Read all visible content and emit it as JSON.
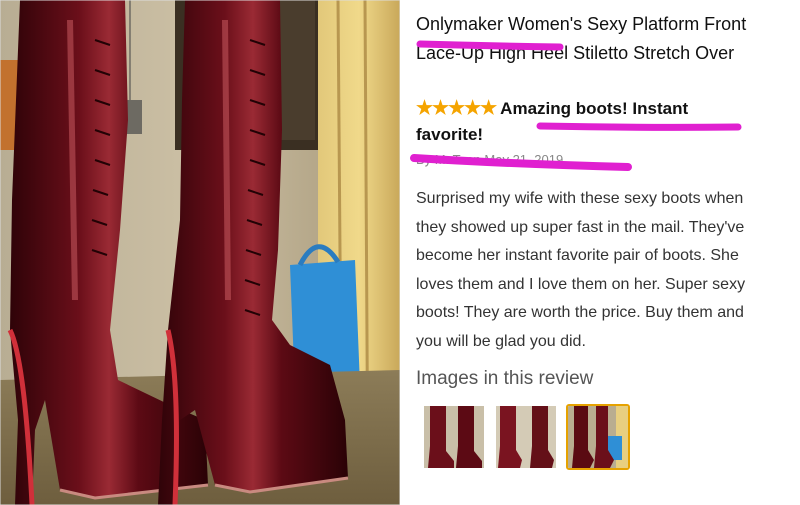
{
  "product": {
    "title_line1": "Onlymaker Women's Sexy Platform Front",
    "title_line2": "Lace-Up High Heel Stiletto Stretch Over"
  },
  "review": {
    "stars": "★★★★★",
    "rating": 5,
    "headline_line1": "Amazing boots! Instant",
    "headline_line2": "favorite!",
    "byline": "By M. T. on May 21, 2019",
    "body_lines": [
      "Surprised my wife with these sexy boots when",
      "they showed up super fast in the mail. They've",
      "become her instant favorite pair of boots. She",
      "loves them and I love them on her. Super sexy",
      "boots! They are worth the price. Buy them and",
      "you will be glad you did."
    ]
  },
  "images_section": {
    "title": "Images in this review",
    "thumbnails": [
      "thumbnail-1",
      "thumbnail-2",
      "thumbnail-3"
    ],
    "selected_index": 2
  },
  "colors": {
    "highlight": "#e020d0",
    "star": "#f5a400",
    "boot": "#5a0a12",
    "selected_border": "#e6a200"
  }
}
